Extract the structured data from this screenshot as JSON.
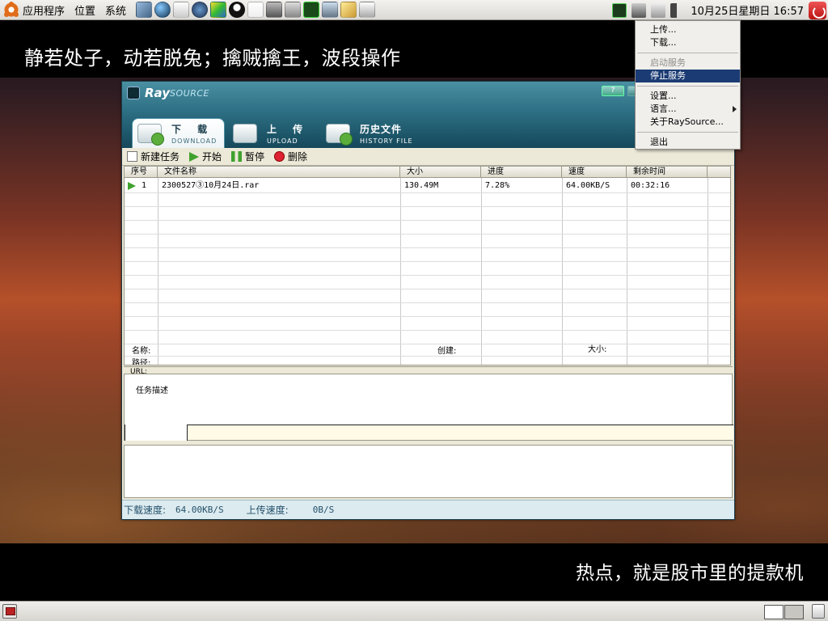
{
  "top_panel": {
    "menus": [
      "应用程序",
      "位置",
      "系统"
    ],
    "clock": "10月25日星期日 16:57",
    "launcher_icons": [
      "cube-icon",
      "globe-icon",
      "mail-icon",
      "help-icon",
      "palette-icon",
      "qq-penguin-icon",
      "text-editor-icon",
      "camera-icon",
      "calculator-icon",
      "system-monitor-icon",
      "computer-icon",
      "key-icon",
      "gnome-chart-icon"
    ],
    "tray_icons": [
      "raysource-tray-icon",
      "network-icon",
      "printer-icon",
      "volume-icon"
    ]
  },
  "captions": {
    "top": "静若处子，动若脱兔；擒贼擒王，波段操作",
    "bottom": "热点，就是股市里的提款机"
  },
  "raysource": {
    "logo_ray": "Ray",
    "logo_source": "SOURCE",
    "help_label": "?",
    "tabs": [
      {
        "title": "下 载",
        "subtitle": "DOWNLOAD",
        "active": true
      },
      {
        "title": "上 传",
        "subtitle": "UPLOAD",
        "active": false
      },
      {
        "title": "历史文件",
        "subtitle": "HISTORY FILE",
        "active": false
      }
    ],
    "toolbar": {
      "new_task": "新建任务",
      "start": "开始",
      "pause": "暂停",
      "delete": "删除"
    },
    "table": {
      "columns": [
        "序号",
        "文件名称",
        "大小",
        "进度",
        "速度",
        "剩余时间"
      ],
      "rows": [
        {
          "index": "1",
          "name": "2300527③10月24日.rar",
          "size": "130.49M",
          "progress": "7.28%",
          "speed": "64.00KB/S",
          "remaining": "00:32:16"
        }
      ]
    },
    "details": {
      "name_label": "名称:",
      "path_label": "路径:",
      "created_label": "创建:",
      "size_label": "大小:",
      "url_label": "URL:"
    },
    "description_label": "任务描述",
    "status": {
      "download_label": "下载速度:",
      "download_value": "64.00KB/S",
      "upload_label": "上传速度:",
      "upload_value": "0B/S"
    }
  },
  "tray_menu": {
    "items": [
      {
        "label": "上传...",
        "disabled": false
      },
      {
        "label": "下载...",
        "disabled": false
      },
      {
        "label": "启动服务",
        "disabled": true
      },
      {
        "label": "停止服务",
        "disabled": false,
        "highlighted": true
      },
      {
        "label": "设置...",
        "disabled": false
      },
      {
        "label": "语言...",
        "disabled": false,
        "submenu": true
      },
      {
        "label": "关于RaySource...",
        "disabled": false
      },
      {
        "label": "退出",
        "disabled": false
      }
    ]
  },
  "colors": {
    "menu_highlight": "#1b3b74",
    "raysource_header": "#2d6f84",
    "status_text": "#24506a"
  }
}
